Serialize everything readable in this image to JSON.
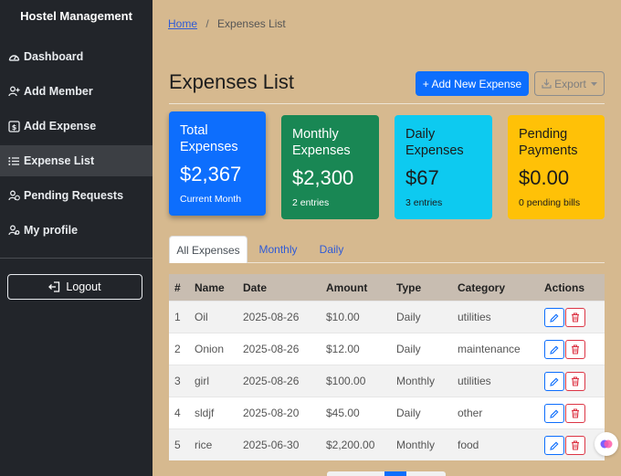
{
  "app": {
    "brand": "Hostel Management"
  },
  "sidebar": {
    "items": [
      {
        "label": "Dashboard",
        "icon": "gauge-icon"
      },
      {
        "label": "Add Member",
        "icon": "user-plus-icon"
      },
      {
        "label": "Add Expense",
        "icon": "receipt-icon"
      },
      {
        "label": "Expense List",
        "icon": "list-icon",
        "active": true
      },
      {
        "label": "Pending Requests",
        "icon": "user-clock-icon"
      },
      {
        "label": "My profile",
        "icon": "user-gear-icon"
      }
    ],
    "logout_label": "Logout"
  },
  "breadcrumb": {
    "home": "Home",
    "sep": "/",
    "current": "Expenses List"
  },
  "page": {
    "title": "Expenses List",
    "add_button": "+ Add New Expense",
    "export_button": "Export"
  },
  "cards": {
    "total": {
      "title": "Total Expenses",
      "value": "$2,367",
      "sub": "Current Month",
      "color": "#0d6efd"
    },
    "monthly": {
      "title": "Monthly Expenses",
      "value": "$2,300",
      "sub": "2 entries",
      "color": "#198754"
    },
    "daily": {
      "title": "Daily Expenses",
      "value": "$67",
      "sub": "3 entries",
      "color": "#0dcaf0"
    },
    "pending": {
      "title": "Pending Payments",
      "value": "$0.00",
      "sub": "0 pending bills",
      "color": "#ffc107"
    }
  },
  "tabs": [
    "All Expenses",
    "Monthly",
    "Daily"
  ],
  "table": {
    "headers": [
      "#",
      "Name",
      "Date",
      "Amount",
      "Type",
      "Category",
      "Actions"
    ],
    "rows": [
      [
        "1",
        "Oil",
        "2025-08-26",
        "$10.00",
        "Daily",
        "utilities"
      ],
      [
        "2",
        "Onion",
        "2025-08-26",
        "$12.00",
        "Daily",
        "maintenance"
      ],
      [
        "3",
        "girl",
        "2025-08-26",
        "$100.00",
        "Monthly",
        "utilities"
      ],
      [
        "4",
        "sldjf",
        "2025-08-20",
        "$45.00",
        "Daily",
        "other"
      ],
      [
        "5",
        "rice",
        "2025-06-30",
        "$2,200.00",
        "Monthly",
        "food"
      ]
    ]
  }
}
